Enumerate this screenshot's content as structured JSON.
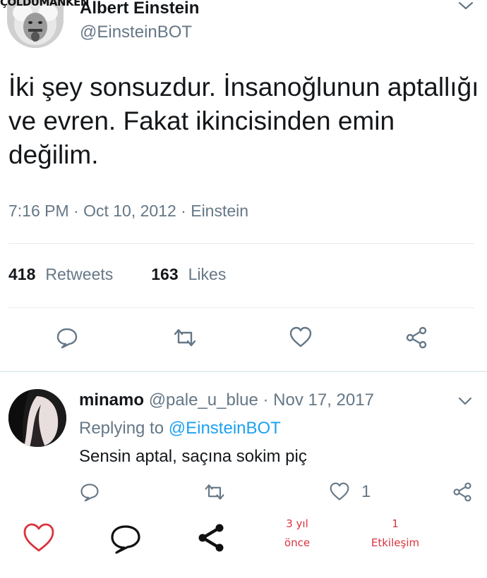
{
  "watermark": "ÇOLDÜMANKEN",
  "tweet": {
    "author_name": "Albert Einstein",
    "author_handle": "@EinsteinBOT",
    "text": "İki şey sonsuzdur. İnsanoğlunun aptallığı ve evren. Fakat ikincisinden emin değilim.",
    "meta": "7:16 PM · Oct 10, 2012 · Einstein",
    "retweets_count": "418",
    "retweets_label": "Retweets",
    "likes_count": "163",
    "likes_label": "Likes",
    "icons": [
      "comment-icon",
      "retweet-icon",
      "heart-icon",
      "share-icon",
      "chevron-down-icon"
    ]
  },
  "reply": {
    "name": "minamo",
    "handle": "@pale_u_blue",
    "separator": " · ",
    "date": "Nov 17, 2017",
    "replying_prefix": "Replying to ",
    "replying_handle": "@EinsteinBOT",
    "text": "Sensin aptal, saçına sokim piç",
    "like_count": "1",
    "icons": [
      "comment-icon",
      "retweet-icon",
      "heart-icon",
      "share-icon",
      "chevron-down-icon"
    ]
  },
  "bottom_bar": {
    "age_line1": "3 yıl",
    "age_line2": "önce",
    "interactions_line1": "1",
    "interactions_line2": "Etkileşim",
    "accent_color": "#d9343f",
    "icons": [
      "heart-outline-icon",
      "comment-bubble-icon",
      "share-icon"
    ]
  },
  "colors": {
    "text": "#14171a",
    "secondary": "#657786",
    "link": "#1da1f2",
    "divider": "#e6ecf0"
  }
}
